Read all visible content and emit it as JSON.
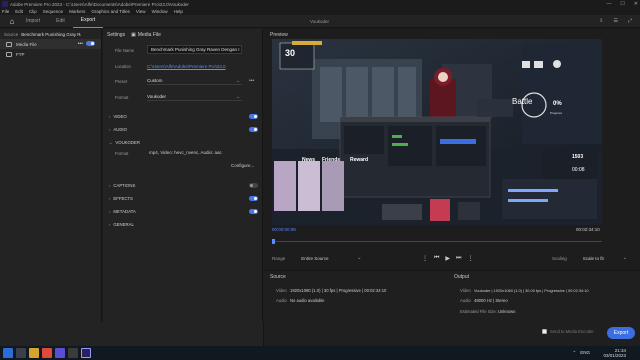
{
  "window": {
    "title": "Adobe Premiere Pro 2023 - C:\\Users\\Alfe\\Documents\\Adobe\\Premiere Pro\\23.0\\Voukoder",
    "controls": [
      "—",
      "☐",
      "✕"
    ]
  },
  "menu": [
    "File",
    "Edit",
    "Clip",
    "Sequence",
    "Markers",
    "Graphics and Titles",
    "View",
    "Window",
    "Help"
  ],
  "nav": {
    "tabs": [
      "Import",
      "Edit",
      "Export"
    ],
    "active_tab": "Export",
    "project": "Voukoder"
  },
  "source_panel": {
    "label": "Source",
    "value": "Benchmark Punishing Gray Ra...",
    "items": [
      {
        "label": "Media File",
        "enabled": true
      },
      {
        "label": "FTP",
        "enabled": false
      }
    ]
  },
  "settings": {
    "header": "Settings",
    "media_file_label": "Media File",
    "file_name_label": "File Name",
    "file_name_value": "Benchmark Punishing Gray Raven Dengan I",
    "location_label": "Location",
    "location_value": "C:\\Users\\Alfe\\Adobe\\Premiere Pro\\23.0",
    "preset_label": "Preset",
    "preset_value": "Custom",
    "format_label": "Format",
    "format_value": "Voukoder",
    "sections": [
      {
        "name": "VIDEO",
        "enabled": true
      },
      {
        "name": "AUDIO",
        "enabled": true
      },
      {
        "name": "VOUKODER",
        "enabled": null
      },
      {
        "name": "CAPTIONS",
        "enabled": false
      },
      {
        "name": "EFFECTS",
        "enabled": true
      },
      {
        "name": "METADATA",
        "enabled": true
      },
      {
        "name": "GENERAL",
        "enabled": null
      }
    ],
    "voukoder_format_label": "Format",
    "voukoder_format_value": "mp4, Video: hevc_nvenc, Audio: aac",
    "configure_label": "Configure..."
  },
  "preview": {
    "label": "Preview",
    "timecode_in": "00:00:00:09",
    "timecode_out": "00:02:34:10",
    "range_label": "Range",
    "range_value": "Entire Source",
    "scaling_label": "Scaling",
    "scaling_value": "Scale to fit",
    "progress": 0.0,
    "game_text": {
      "battle": "Battle",
      "progress_pct": "0%",
      "progress_word": "Progress",
      "news": "News",
      "friends": "Friends",
      "reward": "Reward",
      "level": "30",
      "count": "1503",
      "time": "00:08"
    }
  },
  "source_info": {
    "label": "Source",
    "video_label": "Video",
    "video_value": "1920x1080 (1.0)  |  30 fps  |  Progressive  |  00:02:34:10",
    "audio_label": "Audio",
    "audio_value": "No audio available"
  },
  "output_info": {
    "label": "Output",
    "video_label": "Video",
    "video_value": "Voukoder  |  1920x1080 (1.0)  |  30.00 fps  |  Progressive  |  00:02:34:10",
    "audio_label": "Audio",
    "audio_value": "48000 Hz  |  Stereo",
    "size_label": "Estimated File Size:",
    "size_value": "Unknown"
  },
  "export_bar": {
    "send_label": "Send to Media Encoder",
    "export_label": "Export"
  },
  "taskbar": {
    "clock_time": "21:34",
    "clock_date": "03/01/2023",
    "tray": [
      "ENG",
      "⌃"
    ]
  },
  "colors": {
    "accent": "#3b6ee0",
    "toggle_on": "#4b78e8",
    "panel_bg": "#232323"
  }
}
